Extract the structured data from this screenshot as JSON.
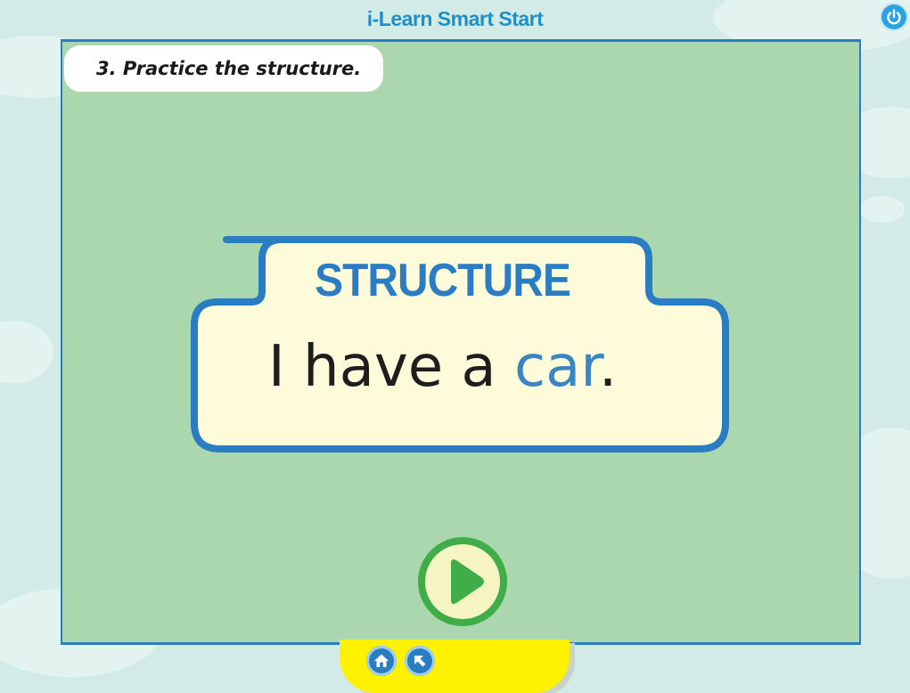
{
  "app": {
    "title": "i-Learn Smart Start"
  },
  "activity": {
    "instruction": "3. Practice the structure.",
    "card_title": "STRUCTURE",
    "sentence_prefix": "I have a ",
    "sentence_highlight": "car",
    "sentence_suffix": "."
  },
  "icons": {
    "power": "power-icon",
    "play": "play-icon",
    "home": "home-icon",
    "back": "back-arrow-icon"
  },
  "colors": {
    "accent_blue": "#2a7dc2",
    "stage_green": "#abd7ae",
    "card_cream": "#fdfbd9",
    "play_green": "#3fae49",
    "bar_yellow": "#fff200"
  }
}
